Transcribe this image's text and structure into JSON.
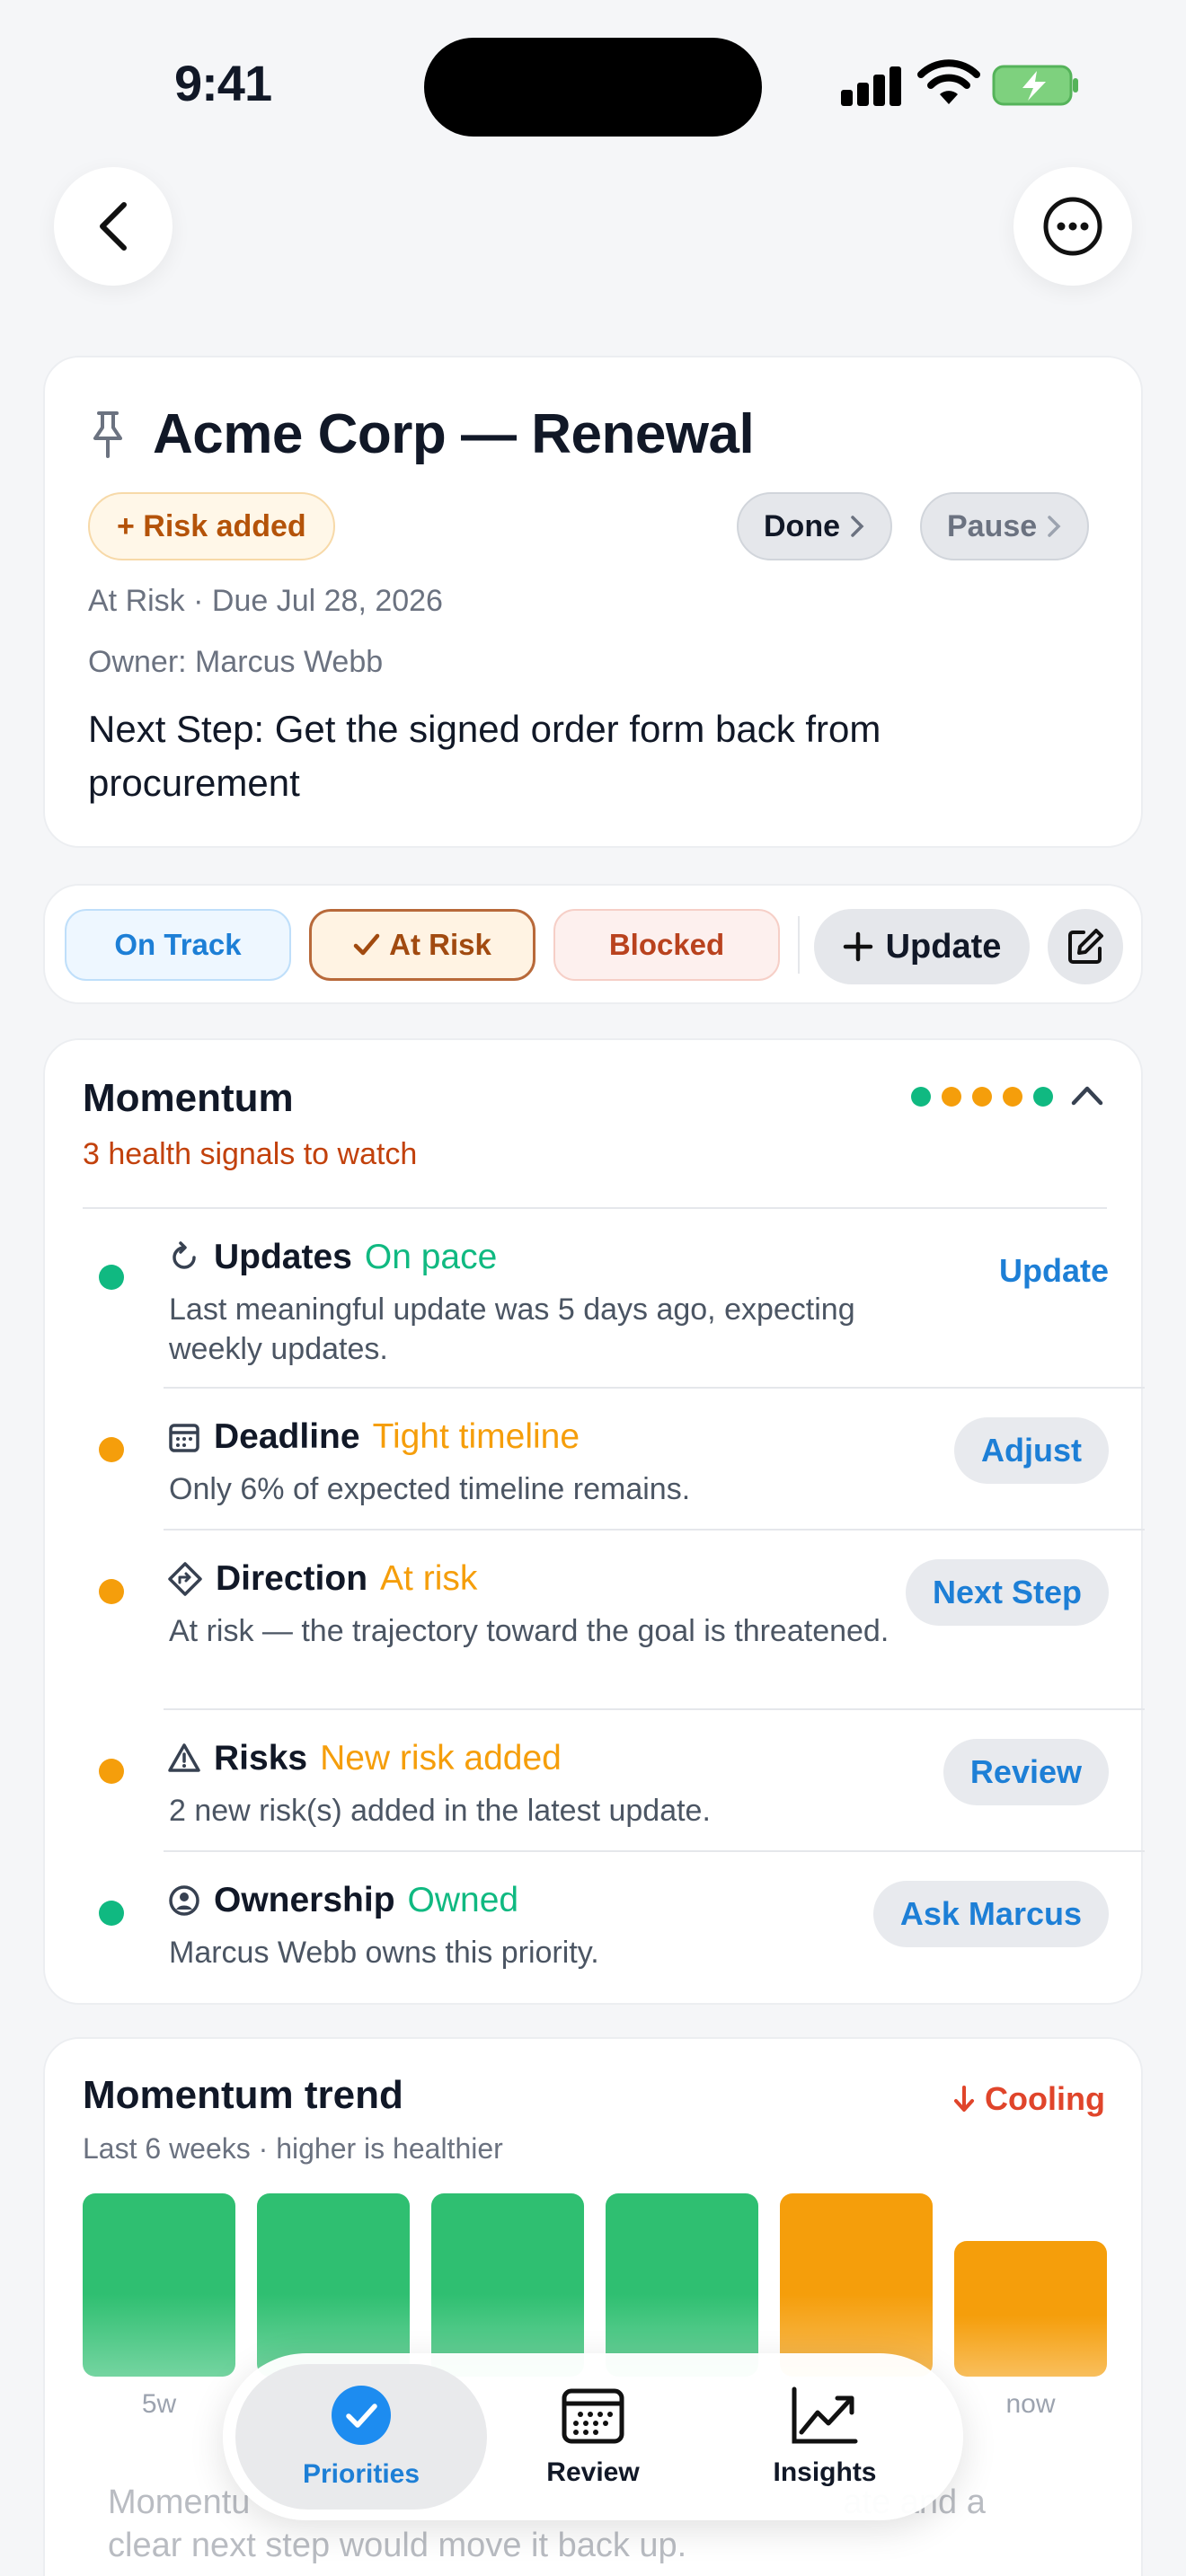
{
  "status_bar": {
    "time": "9:41"
  },
  "header": {
    "title": "Acme Corp — Renewal",
    "risk_chip": "+ Risk added",
    "done_label": "Done",
    "pause_label": "Pause",
    "status_due": "At Risk · Due Jul 28, 2026",
    "owner": "Owner: Marcus Webb",
    "next_step": "Next Step: Get the signed order form back from procurement"
  },
  "status_selector": {
    "on_track": "On Track",
    "at_risk": "At Risk",
    "blocked": "Blocked",
    "selected": "At Risk",
    "update_label": "Update"
  },
  "momentum": {
    "title": "Momentum",
    "subtitle": "3 health signals to watch",
    "dot_colors": [
      "#10b981",
      "#f59e0b",
      "#f59e0b",
      "#f59e0b",
      "#10b981"
    ],
    "signals": [
      {
        "name": "Updates",
        "state": "On pace",
        "state_color": "#10b981",
        "dot_color": "#10b981",
        "icon": "refresh-icon",
        "desc": "Last meaningful update was 5 days ago, expecting weekly updates.",
        "action": "Update"
      },
      {
        "name": "Deadline",
        "state": "Tight timeline",
        "state_color": "#f59e0b",
        "dot_color": "#f59e0b",
        "icon": "calendar-icon",
        "desc": "Only 6% of expected timeline remains.",
        "action": "Adjust"
      },
      {
        "name": "Direction",
        "state": "At risk",
        "state_color": "#f59e0b",
        "dot_color": "#f59e0b",
        "icon": "direction-icon",
        "desc": "At risk — the trajectory toward the goal is threatened.",
        "action": "Next Step"
      },
      {
        "name": "Risks",
        "state": "New risk added",
        "state_color": "#f59e0b",
        "dot_color": "#f59e0b",
        "icon": "warning-icon",
        "desc": "2 new risk(s) added in the latest update.",
        "action": "Review"
      },
      {
        "name": "Ownership",
        "state": "Owned",
        "state_color": "#10b981",
        "dot_color": "#10b981",
        "icon": "person-icon",
        "desc": "Marcus Webb owns this priority.",
        "action": "Ask Marcus"
      }
    ]
  },
  "trend": {
    "title": "Momentum trend",
    "subtitle": "Last 6 weeks · higher is healthier",
    "badge": "Cooling",
    "labels": [
      "5w",
      "",
      "",
      "",
      "",
      "now"
    ],
    "values": [
      1.0,
      1.0,
      1.0,
      1.0,
      1.0,
      0.74
    ],
    "colors": [
      "#2fbf71",
      "#2fbf71",
      "#2fbf71",
      "#2fbf71",
      "#f59e0b",
      "#f59e0b"
    ],
    "note_left": "Momentu",
    "note_right": "ate and a",
    "note_line2": "clear next step would move it back up."
  },
  "tabs": {
    "priorities": "Priorities",
    "review": "Review",
    "insights": "Insights"
  }
}
